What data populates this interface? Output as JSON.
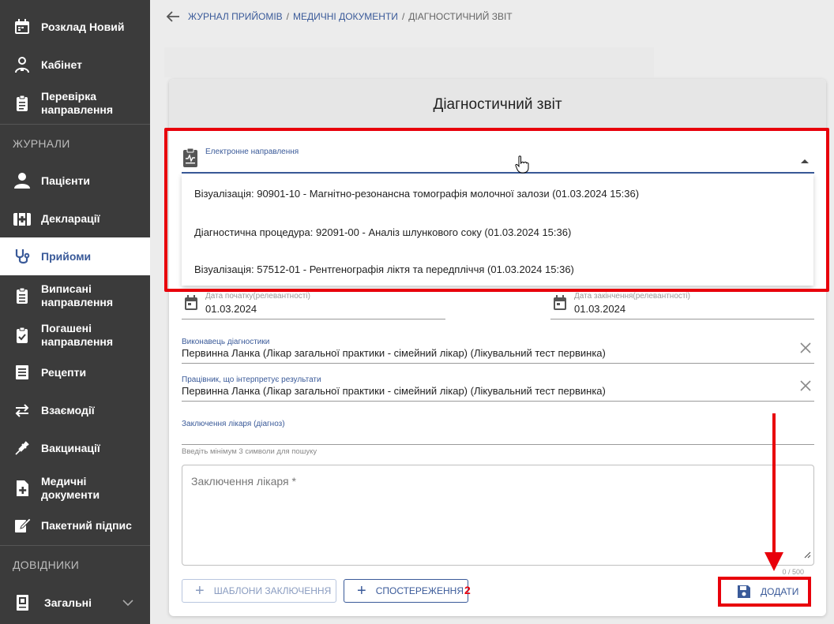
{
  "sidebar": {
    "items": [
      {
        "label": "Розклад Новий",
        "icon": "calendar-icon"
      },
      {
        "label": "Кабінет",
        "icon": "doctor-icon"
      },
      {
        "label": "Перевірка\nнаправлення",
        "icon": "clipboard-icon"
      },
      {
        "label": "Пацієнти",
        "icon": "person-icon"
      },
      {
        "label": "Декларації",
        "icon": "medical-kit-icon"
      },
      {
        "label": "Прийоми",
        "icon": "stethoscope-icon"
      },
      {
        "label": "Виписані\nнаправлення",
        "icon": "clipboard-list-icon"
      },
      {
        "label": "Погашені\nнаправлення",
        "icon": "clipboard-check-icon"
      },
      {
        "label": "Рецепти",
        "icon": "list-icon"
      },
      {
        "label": "Взаємодії",
        "icon": "swap-icon"
      },
      {
        "label": "Вакцинації",
        "icon": "syringe-icon"
      },
      {
        "label": "Медичні\nдокументи",
        "icon": "file-plus-icon"
      },
      {
        "label": "Пакетний підпис",
        "icon": "sign-icon"
      },
      {
        "label": "Загальні",
        "icon": "book-icon"
      }
    ],
    "section_journals": "ЖУРНАЛИ",
    "section_reference": "ДОВІДНИКИ",
    "active": "Прийоми"
  },
  "breadcrumb": {
    "items": [
      "ЖУРНАЛ ПРИЙОМІВ",
      "МЕДИЧНІ ДОКУМЕНТИ",
      "ДІАГНОСТИЧНИЙ ЗВІТ"
    ],
    "separator": "/"
  },
  "card": {
    "title": "Діагностичний звіт",
    "referral_label": "Електронне направлення",
    "referral_options": [
      "Візуалізація: 90901-10 - Магнітно-резонансна томографія молочної залози (01.03.2024 15:36)",
      "Діагностична процедура: 92091-00 - Аналіз шлункового соку (01.03.2024 15:36)",
      "Візуалізація: 57512-01 - Рентгенографія ліктя та передпліччя (01.03.2024 15:36)"
    ],
    "start_date_label": "Дата початку(релевантності)",
    "start_date_value": "01.03.2024",
    "end_date_label": "Дата закінчення(релевантності)",
    "end_date_value": "01.03.2024",
    "performer_label": "Виконавець діагностики",
    "performer_value": "Первинна Ланка  (Лікар загальної практики - сімейний лікар) (Лікувальний тест первинка)",
    "interpreter_label": "Працівник, що інтерпретує результати",
    "interpreter_value": "Первинна Ланка  (Лікар загальної практики - сімейний лікар) (Лікувальний тест первинка)",
    "diagnosis_label": "Заключення лікаря (діагноз)",
    "diagnosis_hint": "Введіть мінімум 3 символи для пошуку",
    "conclusion_placeholder": "Заключення лікаря *",
    "counter": "0 / 500",
    "templates_button": "ШАБЛОНИ ЗАКЛЮЧЕННЯ",
    "observations_button": "СПОСТЕРЕЖЕННЯ",
    "add_button": "ДОДАТИ"
  },
  "annotation": {
    "number": "2"
  },
  "colors": {
    "accent": "#3a5a99",
    "sidebar_bg": "#3b3b3b",
    "highlight": "#e8000b"
  }
}
